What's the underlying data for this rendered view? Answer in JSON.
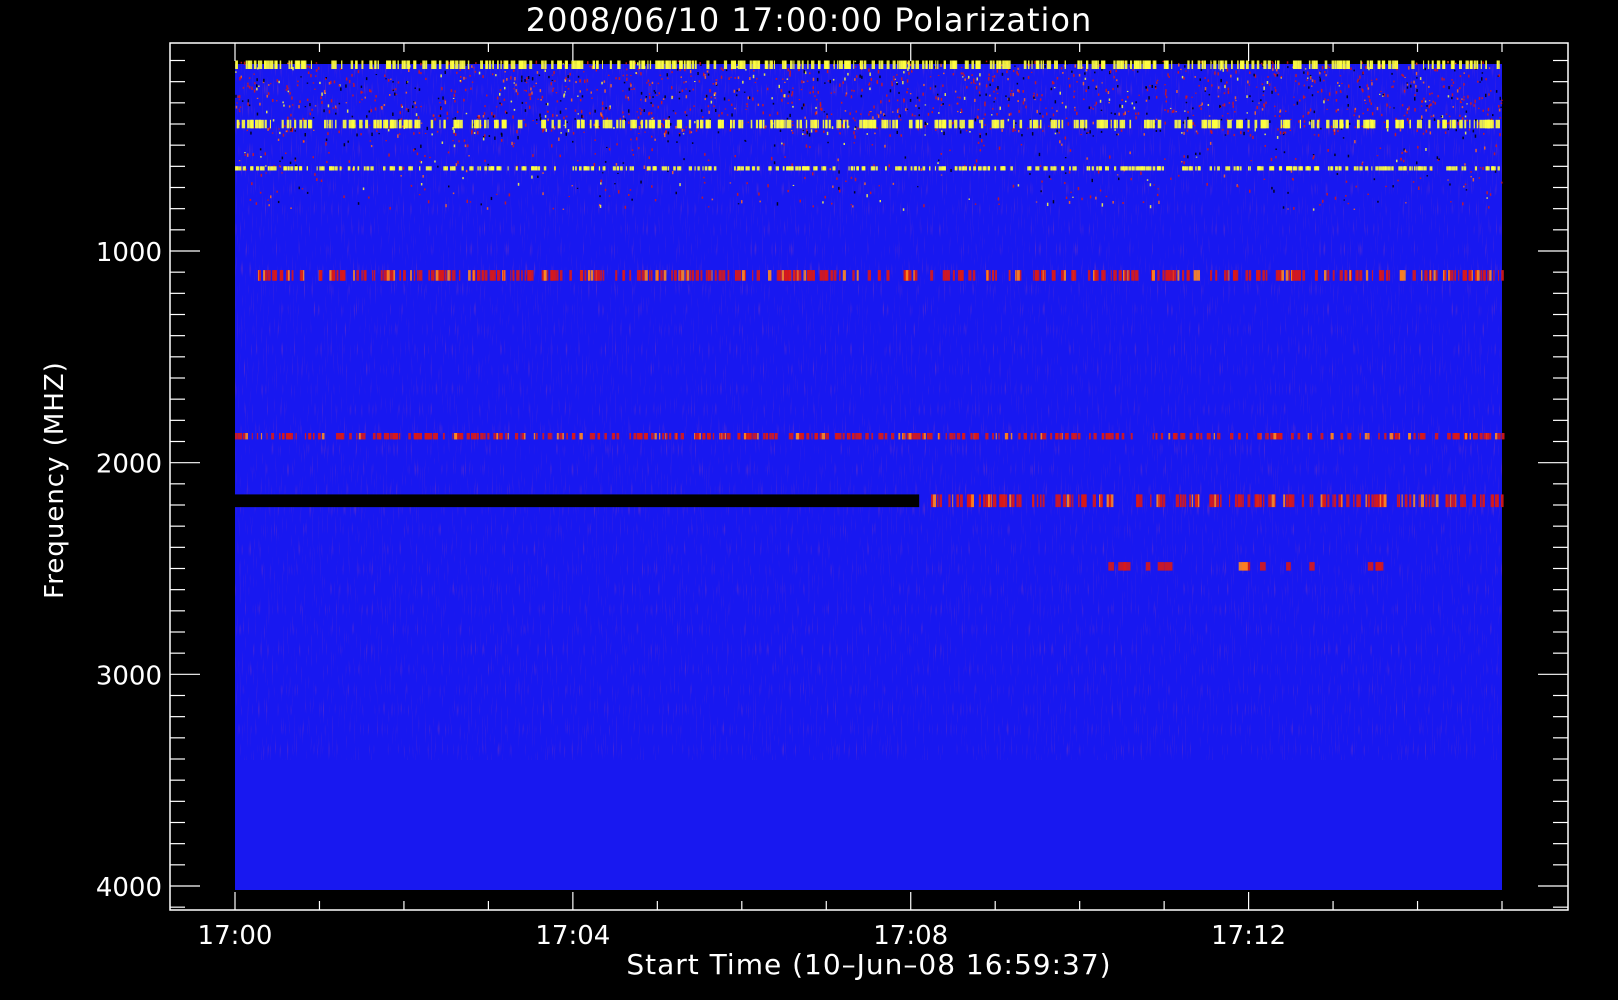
{
  "chart_data": {
    "type": "heatmap",
    "title": "2008/06/10 17:00:00 Polarization",
    "xlabel": "Start Time (10–Jun–08 16:59:37)",
    "ylabel": "Frequency (MHZ)",
    "x_ticks": [
      {
        "minute": 0,
        "label": "17:00"
      },
      {
        "minute": 4,
        "label": "17:04"
      },
      {
        "minute": 8,
        "label": "17:08"
      },
      {
        "minute": 12,
        "label": "17:12"
      }
    ],
    "y_ticks": [
      {
        "mhz": 1000,
        "label": "1000"
      },
      {
        "mhz": 2000,
        "label": "2000"
      },
      {
        "mhz": 3000,
        "label": "3000"
      },
      {
        "mhz": 4000,
        "label": "4000"
      }
    ],
    "y_axis": "inverted",
    "colormap": {
      "low": "#000000",
      "base": "#1818f0",
      "mid": "#d81818",
      "high": "#ffff40"
    },
    "features": [
      {
        "label": "dense RFI / noise band",
        "freq_mhz": [
          100,
          800
        ],
        "time_min": [
          0,
          15
        ],
        "level": "mixed"
      },
      {
        "label": "bright band",
        "freq_mhz": [
          100,
          140
        ],
        "time_min": [
          0,
          15
        ],
        "level": "high"
      },
      {
        "label": "bright band",
        "freq_mhz": [
          380,
          420
        ],
        "time_min": [
          0,
          15
        ],
        "level": "high"
      },
      {
        "label": "line",
        "freq_mhz": [
          600,
          620
        ],
        "time_min": [
          0,
          15
        ],
        "level": "high"
      },
      {
        "label": "dotted line",
        "freq_mhz": [
          1090,
          1140
        ],
        "time_min": [
          0,
          15
        ],
        "level": "mid"
      },
      {
        "label": "faint line",
        "freq_mhz": [
          1860,
          1890
        ],
        "time_min": [
          0,
          15
        ],
        "level": "mid"
      },
      {
        "label": "dark band",
        "freq_mhz": [
          2150,
          2210
        ],
        "time_min": [
          0,
          8.1
        ],
        "level": "low"
      },
      {
        "label": "emission band",
        "freq_mhz": [
          2150,
          2210
        ],
        "time_min": [
          8.1,
          15
        ],
        "level": "mid"
      },
      {
        "label": "patches",
        "freq_mhz": [
          2470,
          2510
        ],
        "time_min": [
          10,
          13.7
        ],
        "level": "mid"
      }
    ],
    "grid": false,
    "legend": "none"
  }
}
